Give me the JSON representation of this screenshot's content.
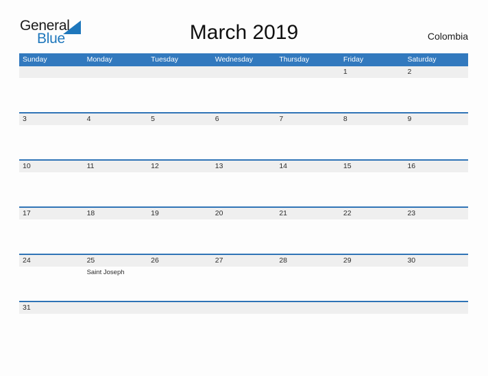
{
  "brand": {
    "name_part1": "General",
    "name_part2": "Blue",
    "triangle_color": "#1e77bc",
    "text_color_primary": "#1a1a1a",
    "text_color_accent": "#1e77bc"
  },
  "header": {
    "title": "March 2019",
    "region": "Colombia"
  },
  "theme": {
    "header_blue": "#3279be",
    "row_border_blue": "#2e73b6",
    "band_gray": "#efefef",
    "page_background": "#fdfdfd",
    "day_text": "#2b2b2b"
  },
  "calendar": {
    "day_names": [
      "Sunday",
      "Monday",
      "Tuesday",
      "Wednesday",
      "Thursday",
      "Friday",
      "Saturday"
    ],
    "weeks": [
      [
        {
          "date": "",
          "events": []
        },
        {
          "date": "",
          "events": []
        },
        {
          "date": "",
          "events": []
        },
        {
          "date": "",
          "events": []
        },
        {
          "date": "",
          "events": []
        },
        {
          "date": "1",
          "events": []
        },
        {
          "date": "2",
          "events": []
        }
      ],
      [
        {
          "date": "3",
          "events": []
        },
        {
          "date": "4",
          "events": []
        },
        {
          "date": "5",
          "events": []
        },
        {
          "date": "6",
          "events": []
        },
        {
          "date": "7",
          "events": []
        },
        {
          "date": "8",
          "events": []
        },
        {
          "date": "9",
          "events": []
        }
      ],
      [
        {
          "date": "10",
          "events": []
        },
        {
          "date": "11",
          "events": []
        },
        {
          "date": "12",
          "events": []
        },
        {
          "date": "13",
          "events": []
        },
        {
          "date": "14",
          "events": []
        },
        {
          "date": "15",
          "events": []
        },
        {
          "date": "16",
          "events": []
        }
      ],
      [
        {
          "date": "17",
          "events": []
        },
        {
          "date": "18",
          "events": []
        },
        {
          "date": "19",
          "events": []
        },
        {
          "date": "20",
          "events": []
        },
        {
          "date": "21",
          "events": []
        },
        {
          "date": "22",
          "events": []
        },
        {
          "date": "23",
          "events": []
        }
      ],
      [
        {
          "date": "24",
          "events": []
        },
        {
          "date": "25",
          "events": [
            "Saint Joseph"
          ]
        },
        {
          "date": "26",
          "events": []
        },
        {
          "date": "27",
          "events": []
        },
        {
          "date": "28",
          "events": []
        },
        {
          "date": "29",
          "events": []
        },
        {
          "date": "30",
          "events": []
        }
      ],
      [
        {
          "date": "31",
          "events": []
        },
        {
          "date": "",
          "events": []
        },
        {
          "date": "",
          "events": []
        },
        {
          "date": "",
          "events": []
        },
        {
          "date": "",
          "events": []
        },
        {
          "date": "",
          "events": []
        },
        {
          "date": "",
          "events": []
        }
      ]
    ]
  }
}
